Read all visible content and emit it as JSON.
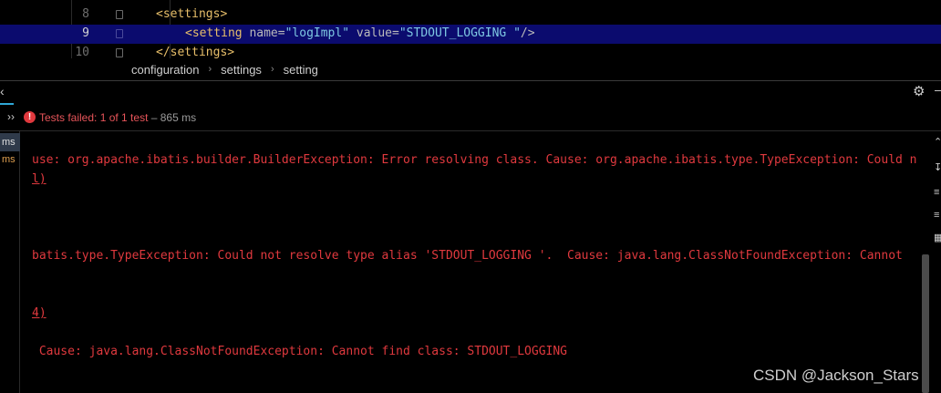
{
  "editor": {
    "lines": [
      {
        "number": "8",
        "open": "<",
        "tag": "settings",
        "close": ">"
      },
      {
        "number": "9",
        "open": "<",
        "tag": "setting",
        "attr1": " name",
        "eq1": "=",
        "val1": "\"logImpl\"",
        "attr2": " value",
        "eq2": "=",
        "val2": "\"STDOUT_LOGGING \"",
        "end": "/>"
      },
      {
        "number": "10",
        "text": "</settings>"
      }
    ]
  },
  "breadcrumb": {
    "items": [
      "configuration",
      "settings",
      "setting"
    ],
    "separator": "›"
  },
  "tool_window": {
    "chevron": "››",
    "status": {
      "failed_text": "Tests failed: 1 of 1 test",
      "duration_text": "– 865 ms"
    },
    "tree": [
      "ms",
      "ms"
    ]
  },
  "console": {
    "lines": [
      "use: org.apache.ibatis.builder.BuilderException: Error resolving class. Cause: org.apache.ibatis.type.TypeException: Could n",
      "l)",
      "batis.type.TypeException: Could not resolve type alias 'STDOUT_LOGGING '.  Cause: java.lang.ClassNotFoundException: Cannot",
      "4)",
      " Cause: java.lang.ClassNotFoundException: Cannot find class: STDOUT_LOGGING"
    ]
  },
  "watermark": "CSDN @Jackson_Stars",
  "colors": {
    "error": "#e0393e",
    "selection": "#0b0b6e",
    "tag": "#e8bf6a",
    "string": "#6a8759",
    "accent": "#2fa7d6"
  },
  "icons": [
    "fold-marker-icon",
    "close-tab-icon",
    "gear-icon",
    "minimize-icon",
    "fail-icon",
    "expand-chevron-icon",
    "scroll-to-end-icon"
  ]
}
